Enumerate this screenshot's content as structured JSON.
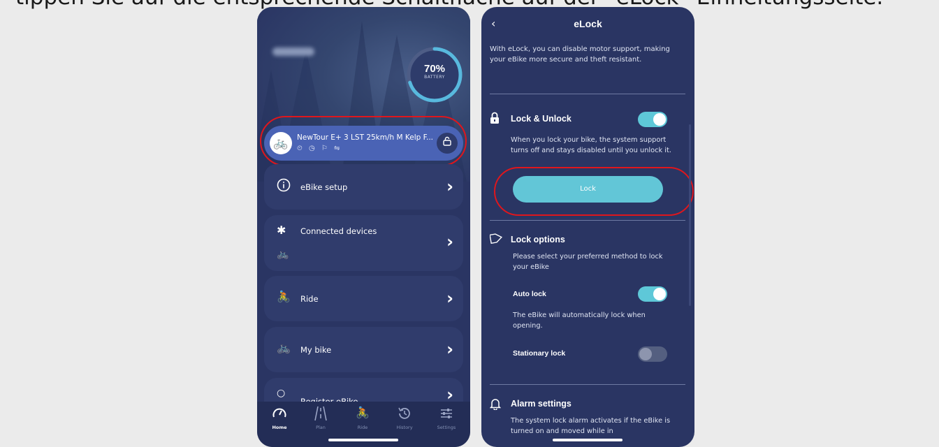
{
  "caption": "tippen Sie auf die entsprechende Schaltfläche auf der \"eLock\"-Einheitungsseite.",
  "left_screen": {
    "battery": {
      "percent": "70%",
      "label": "BATTERY",
      "level": 0.7
    },
    "bike": {
      "name": "NewTour E+ 3 LST 25km/h M Kelp F...",
      "status_icons": "⏲ ◷ ⚐ ⇋"
    },
    "menu": [
      {
        "label": "eBike setup",
        "icon": "info-icon"
      },
      {
        "label": "Connected devices",
        "icon": "bluetooth-icon"
      },
      {
        "label": "Ride",
        "icon": "cyclist-icon"
      },
      {
        "label": "My bike",
        "icon": "bike-icon"
      },
      {
        "label": "Register eBike",
        "icon": "register-icon"
      }
    ],
    "tabs": [
      {
        "label": "Home",
        "icon": "speedometer-icon"
      },
      {
        "label": "Plan",
        "icon": "road-icon"
      },
      {
        "label": "Ride",
        "icon": "cyclist-icon"
      },
      {
        "label": "History",
        "icon": "history-icon"
      },
      {
        "label": "Settings",
        "icon": "sliders-icon"
      }
    ]
  },
  "right_screen": {
    "title": "eLock",
    "intro": "With eLock, you can disable motor support, making your eBike more secure and theft resistant.",
    "lock_unlock": {
      "title": "Lock & Unlock",
      "enabled": true,
      "description": "When you lock your bike, the system support turns off and stays disabled until you unlock it.",
      "button": "Lock"
    },
    "lock_options": {
      "title": "Lock options",
      "description": "Please select your preferred method to lock your eBike",
      "auto_lock": {
        "label": "Auto lock",
        "enabled": true,
        "description": "The eBike will automatically lock when opening."
      },
      "stationary_lock": {
        "label": "Stationary lock",
        "enabled": false
      }
    },
    "alarm": {
      "title": "Alarm settings",
      "description": "The system lock alarm activates if the eBike is turned on and moved while in"
    }
  },
  "colors": {
    "background": "#2a3563",
    "accent": "#5ec8d8",
    "highlight": "#e0161c",
    "card": "#4a63b5"
  }
}
